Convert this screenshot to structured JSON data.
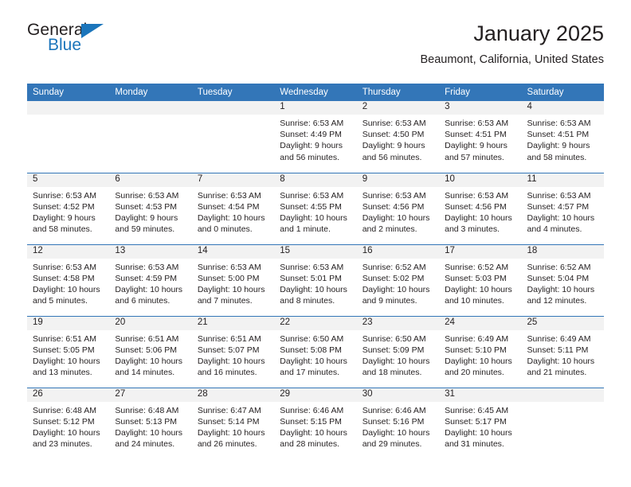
{
  "logo": {
    "primary_text": "General",
    "secondary_text": "Blue",
    "primary_color": "#231f20",
    "accent_color": "#1b75bb",
    "triangle_icon": "triangle-icon"
  },
  "header": {
    "title": "January 2025",
    "subtitle": "Beaumont, California, United States"
  },
  "theme": {
    "header_bar_color": "#3376b8",
    "daynum_bar_color": "#f2f2f2",
    "row_divider_color": "#3376b8",
    "text_color": "#231f20"
  },
  "weekday_headers": [
    "Sunday",
    "Monday",
    "Tuesday",
    "Wednesday",
    "Thursday",
    "Friday",
    "Saturday"
  ],
  "labels": {
    "sunrise_prefix": "Sunrise:",
    "sunset_prefix": "Sunset:",
    "daylight_prefix": "Daylight:"
  },
  "weeks": [
    [
      {
        "day": "",
        "empty": true
      },
      {
        "day": "",
        "empty": true
      },
      {
        "day": "",
        "empty": true
      },
      {
        "day": "1",
        "sunrise": "Sunrise: 6:53 AM",
        "sunset": "Sunset: 4:49 PM",
        "daylight_line1": "Daylight: 9 hours",
        "daylight_line2": "and 56 minutes."
      },
      {
        "day": "2",
        "sunrise": "Sunrise: 6:53 AM",
        "sunset": "Sunset: 4:50 PM",
        "daylight_line1": "Daylight: 9 hours",
        "daylight_line2": "and 56 minutes."
      },
      {
        "day": "3",
        "sunrise": "Sunrise: 6:53 AM",
        "sunset": "Sunset: 4:51 PM",
        "daylight_line1": "Daylight: 9 hours",
        "daylight_line2": "and 57 minutes."
      },
      {
        "day": "4",
        "sunrise": "Sunrise: 6:53 AM",
        "sunset": "Sunset: 4:51 PM",
        "daylight_line1": "Daylight: 9 hours",
        "daylight_line2": "and 58 minutes."
      }
    ],
    [
      {
        "day": "5",
        "sunrise": "Sunrise: 6:53 AM",
        "sunset": "Sunset: 4:52 PM",
        "daylight_line1": "Daylight: 9 hours",
        "daylight_line2": "and 58 minutes."
      },
      {
        "day": "6",
        "sunrise": "Sunrise: 6:53 AM",
        "sunset": "Sunset: 4:53 PM",
        "daylight_line1": "Daylight: 9 hours",
        "daylight_line2": "and 59 minutes."
      },
      {
        "day": "7",
        "sunrise": "Sunrise: 6:53 AM",
        "sunset": "Sunset: 4:54 PM",
        "daylight_line1": "Daylight: 10 hours",
        "daylight_line2": "and 0 minutes."
      },
      {
        "day": "8",
        "sunrise": "Sunrise: 6:53 AM",
        "sunset": "Sunset: 4:55 PM",
        "daylight_line1": "Daylight: 10 hours",
        "daylight_line2": "and 1 minute."
      },
      {
        "day": "9",
        "sunrise": "Sunrise: 6:53 AM",
        "sunset": "Sunset: 4:56 PM",
        "daylight_line1": "Daylight: 10 hours",
        "daylight_line2": "and 2 minutes."
      },
      {
        "day": "10",
        "sunrise": "Sunrise: 6:53 AM",
        "sunset": "Sunset: 4:56 PM",
        "daylight_line1": "Daylight: 10 hours",
        "daylight_line2": "and 3 minutes."
      },
      {
        "day": "11",
        "sunrise": "Sunrise: 6:53 AM",
        "sunset": "Sunset: 4:57 PM",
        "daylight_line1": "Daylight: 10 hours",
        "daylight_line2": "and 4 minutes."
      }
    ],
    [
      {
        "day": "12",
        "sunrise": "Sunrise: 6:53 AM",
        "sunset": "Sunset: 4:58 PM",
        "daylight_line1": "Daylight: 10 hours",
        "daylight_line2": "and 5 minutes."
      },
      {
        "day": "13",
        "sunrise": "Sunrise: 6:53 AM",
        "sunset": "Sunset: 4:59 PM",
        "daylight_line1": "Daylight: 10 hours",
        "daylight_line2": "and 6 minutes."
      },
      {
        "day": "14",
        "sunrise": "Sunrise: 6:53 AM",
        "sunset": "Sunset: 5:00 PM",
        "daylight_line1": "Daylight: 10 hours",
        "daylight_line2": "and 7 minutes."
      },
      {
        "day": "15",
        "sunrise": "Sunrise: 6:53 AM",
        "sunset": "Sunset: 5:01 PM",
        "daylight_line1": "Daylight: 10 hours",
        "daylight_line2": "and 8 minutes."
      },
      {
        "day": "16",
        "sunrise": "Sunrise: 6:52 AM",
        "sunset": "Sunset: 5:02 PM",
        "daylight_line1": "Daylight: 10 hours",
        "daylight_line2": "and 9 minutes."
      },
      {
        "day": "17",
        "sunrise": "Sunrise: 6:52 AM",
        "sunset": "Sunset: 5:03 PM",
        "daylight_line1": "Daylight: 10 hours",
        "daylight_line2": "and 10 minutes."
      },
      {
        "day": "18",
        "sunrise": "Sunrise: 6:52 AM",
        "sunset": "Sunset: 5:04 PM",
        "daylight_line1": "Daylight: 10 hours",
        "daylight_line2": "and 12 minutes."
      }
    ],
    [
      {
        "day": "19",
        "sunrise": "Sunrise: 6:51 AM",
        "sunset": "Sunset: 5:05 PM",
        "daylight_line1": "Daylight: 10 hours",
        "daylight_line2": "and 13 minutes."
      },
      {
        "day": "20",
        "sunrise": "Sunrise: 6:51 AM",
        "sunset": "Sunset: 5:06 PM",
        "daylight_line1": "Daylight: 10 hours",
        "daylight_line2": "and 14 minutes."
      },
      {
        "day": "21",
        "sunrise": "Sunrise: 6:51 AM",
        "sunset": "Sunset: 5:07 PM",
        "daylight_line1": "Daylight: 10 hours",
        "daylight_line2": "and 16 minutes."
      },
      {
        "day": "22",
        "sunrise": "Sunrise: 6:50 AM",
        "sunset": "Sunset: 5:08 PM",
        "daylight_line1": "Daylight: 10 hours",
        "daylight_line2": "and 17 minutes."
      },
      {
        "day": "23",
        "sunrise": "Sunrise: 6:50 AM",
        "sunset": "Sunset: 5:09 PM",
        "daylight_line1": "Daylight: 10 hours",
        "daylight_line2": "and 18 minutes."
      },
      {
        "day": "24",
        "sunrise": "Sunrise: 6:49 AM",
        "sunset": "Sunset: 5:10 PM",
        "daylight_line1": "Daylight: 10 hours",
        "daylight_line2": "and 20 minutes."
      },
      {
        "day": "25",
        "sunrise": "Sunrise: 6:49 AM",
        "sunset": "Sunset: 5:11 PM",
        "daylight_line1": "Daylight: 10 hours",
        "daylight_line2": "and 21 minutes."
      }
    ],
    [
      {
        "day": "26",
        "sunrise": "Sunrise: 6:48 AM",
        "sunset": "Sunset: 5:12 PM",
        "daylight_line1": "Daylight: 10 hours",
        "daylight_line2": "and 23 minutes."
      },
      {
        "day": "27",
        "sunrise": "Sunrise: 6:48 AM",
        "sunset": "Sunset: 5:13 PM",
        "daylight_line1": "Daylight: 10 hours",
        "daylight_line2": "and 24 minutes."
      },
      {
        "day": "28",
        "sunrise": "Sunrise: 6:47 AM",
        "sunset": "Sunset: 5:14 PM",
        "daylight_line1": "Daylight: 10 hours",
        "daylight_line2": "and 26 minutes."
      },
      {
        "day": "29",
        "sunrise": "Sunrise: 6:46 AM",
        "sunset": "Sunset: 5:15 PM",
        "daylight_line1": "Daylight: 10 hours",
        "daylight_line2": "and 28 minutes."
      },
      {
        "day": "30",
        "sunrise": "Sunrise: 6:46 AM",
        "sunset": "Sunset: 5:16 PM",
        "daylight_line1": "Daylight: 10 hours",
        "daylight_line2": "and 29 minutes."
      },
      {
        "day": "31",
        "sunrise": "Sunrise: 6:45 AM",
        "sunset": "Sunset: 5:17 PM",
        "daylight_line1": "Daylight: 10 hours",
        "daylight_line2": "and 31 minutes."
      },
      {
        "day": "",
        "empty": true
      }
    ]
  ]
}
